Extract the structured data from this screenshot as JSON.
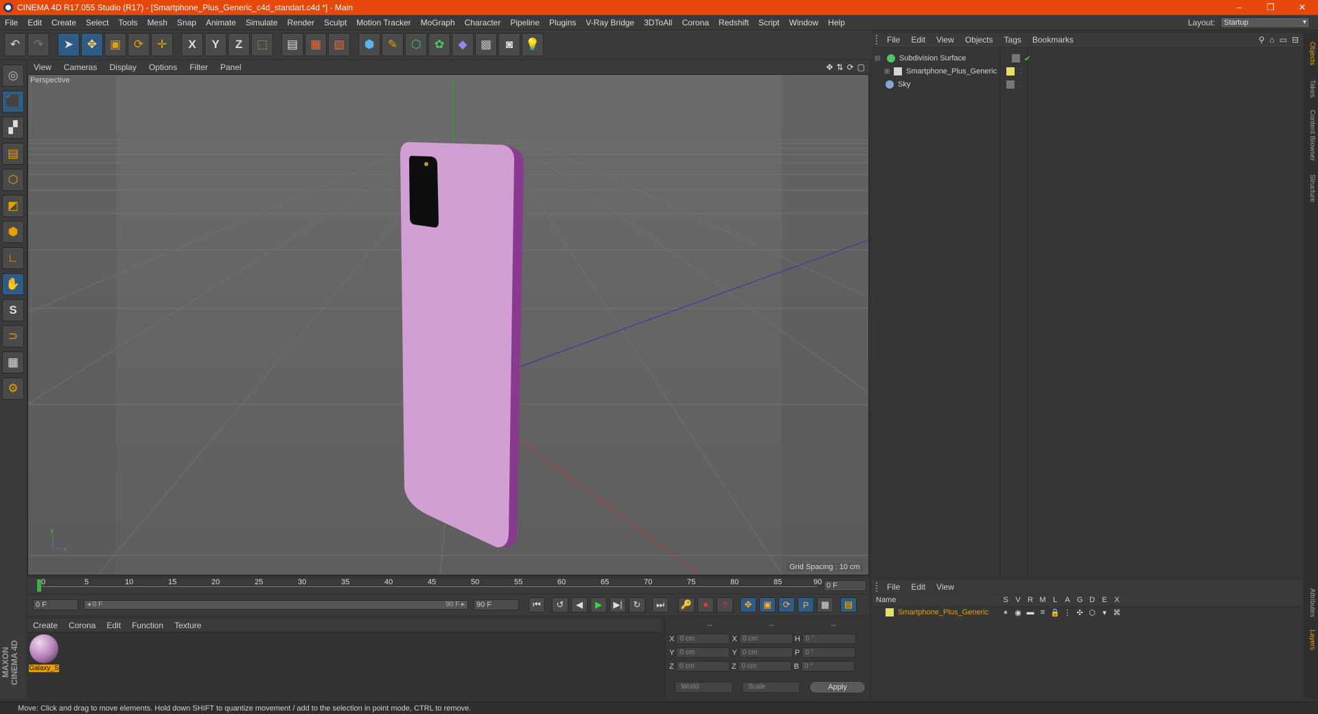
{
  "window": {
    "title": "CINEMA 4D R17.055 Studio (R17) - [Smartphone_Plus_Generic_c4d_standart.c4d *] - Main",
    "minimize": "–",
    "restore": "❐",
    "close": "✕"
  },
  "menubar": {
    "items": [
      "File",
      "Edit",
      "Create",
      "Select",
      "Tools",
      "Mesh",
      "Snap",
      "Animate",
      "Simulate",
      "Render",
      "Sculpt",
      "Motion Tracker",
      "MoGraph",
      "Character",
      "Pipeline",
      "Plugins",
      "V-Ray Bridge",
      "3DToAll",
      "Corona",
      "Redshift",
      "Script",
      "Window",
      "Help"
    ],
    "layout_label": "Layout:",
    "layout_value": "Startup"
  },
  "toolbar": {
    "icons": [
      "undo-icon",
      "redo-icon",
      "select-icon",
      "move-icon",
      "scale-icon",
      "rotate-icon",
      "live-select-icon",
      "x-axis-icon",
      "y-axis-icon",
      "z-axis-icon",
      "coordinate-system-icon",
      "render-view-icon",
      "render-picture-viewer-icon",
      "edit-render-settings-icon",
      "cube-icon",
      "pen-icon",
      "subdivision-icon",
      "mograph-icon",
      "deformer-icon",
      "floor-icon",
      "camera-icon",
      "light-icon"
    ],
    "glyphs": [
      "↶",
      "↷",
      "➤",
      "✥",
      "▣",
      "⟳",
      "✛",
      "X",
      "Y",
      "Z",
      "⬚",
      "▤",
      "▦",
      "▧",
      "⬢",
      "✎",
      "⬡",
      "✿",
      "◆",
      "▩",
      "◙",
      "💡"
    ]
  },
  "lefttools": {
    "icons": [
      "make-editable-icon",
      "model-mode-icon",
      "texture-mode-icon",
      "workplane-icon",
      "points-mode-icon",
      "edges-mode-icon",
      "polygons-mode-icon",
      "axis-icon",
      "tweak-icon",
      "solo-icon",
      "magnet-icon",
      "snap-grid-icon",
      "snap-settings-icon"
    ],
    "glyphs": [
      "◎",
      "⬛",
      "▞",
      "▤",
      "⬡",
      "◩",
      "⬢",
      "∟",
      "✋",
      "S",
      "⊃",
      "▦",
      "⚙"
    ],
    "brand": "MAXON CINEMA 4D"
  },
  "viewport": {
    "menu": [
      "View",
      "Cameras",
      "Display",
      "Options",
      "Filter",
      "Panel"
    ],
    "label": "Perspective",
    "grid_spacing": "Grid Spacing : 10 cm",
    "nav_icons": [
      "✥",
      "⇅",
      "⟳",
      "▢"
    ]
  },
  "timeline": {
    "ticks": [
      "0",
      "5",
      "10",
      "15",
      "20",
      "25",
      "30",
      "35",
      "40",
      "45",
      "50",
      "55",
      "60",
      "65",
      "70",
      "75",
      "80",
      "85",
      "90"
    ],
    "current_frame_field": "0 F",
    "start_field": "0 F",
    "range_start": "◂ 0 F",
    "range_end": "90 F ▸",
    "end_field": "90 F",
    "end_max_field": "90 F"
  },
  "playback": {
    "buttons": [
      "⏮",
      "↺",
      "◀",
      "▶",
      "▶|",
      "↻",
      "⏭"
    ],
    "extra": [
      "🔑",
      "⏺",
      "?",
      "✥",
      "▣",
      "⟳",
      "P",
      "▦",
      "▤"
    ]
  },
  "materials": {
    "menu": [
      "Create",
      "Corona",
      "Edit",
      "Function",
      "Texture"
    ],
    "items": [
      {
        "name": "Galaxy_S"
      }
    ]
  },
  "coordinates": {
    "headers": [
      "--",
      "--",
      "--"
    ],
    "rows": [
      {
        "a": "X",
        "av": "0 cm",
        "b": "X",
        "bv": "0 cm",
        "c": "H",
        "cv": "0 °"
      },
      {
        "a": "Y",
        "av": "0 cm",
        "b": "Y",
        "bv": "0 cm",
        "c": "P",
        "cv": "0 °"
      },
      {
        "a": "Z",
        "av": "0 cm",
        "b": "Z",
        "bv": "0 cm",
        "c": "B",
        "cv": "0 °"
      }
    ],
    "space": "World",
    "mode": "Scale",
    "apply": "Apply"
  },
  "objects": {
    "menu": [
      "File",
      "Edit",
      "View",
      "Objects",
      "Tags",
      "Bookmarks"
    ],
    "rows": [
      {
        "name": "Subdivision Surface",
        "color": "#4fc36a"
      },
      {
        "name": "Smartphone_Plus_Generic",
        "color": "#d6d6d6"
      },
      {
        "name": "Sky",
        "color": "#7fa8d6"
      }
    ]
  },
  "attributes": {
    "menu": [
      "File",
      "Edit",
      "View"
    ],
    "name_header": "Name",
    "cols": [
      "S",
      "V",
      "R",
      "M",
      "L",
      "A",
      "G",
      "D",
      "E",
      "X"
    ],
    "row_name": "Smartphone_Plus_Generic",
    "row_color": "#e6a000"
  },
  "right_tabs": [
    "Objects",
    "Takes",
    "Content Browser",
    "Structure",
    "Attributes",
    "Layers"
  ],
  "status": "Move: Click and drag to move elements. Hold down SHIFT to quantize movement / add to the selection in point mode, CTRL to remove.",
  "colors": {
    "accent": "#e8470a",
    "phone": "#d19fd3",
    "phone_edge": "#8a3a8e"
  }
}
